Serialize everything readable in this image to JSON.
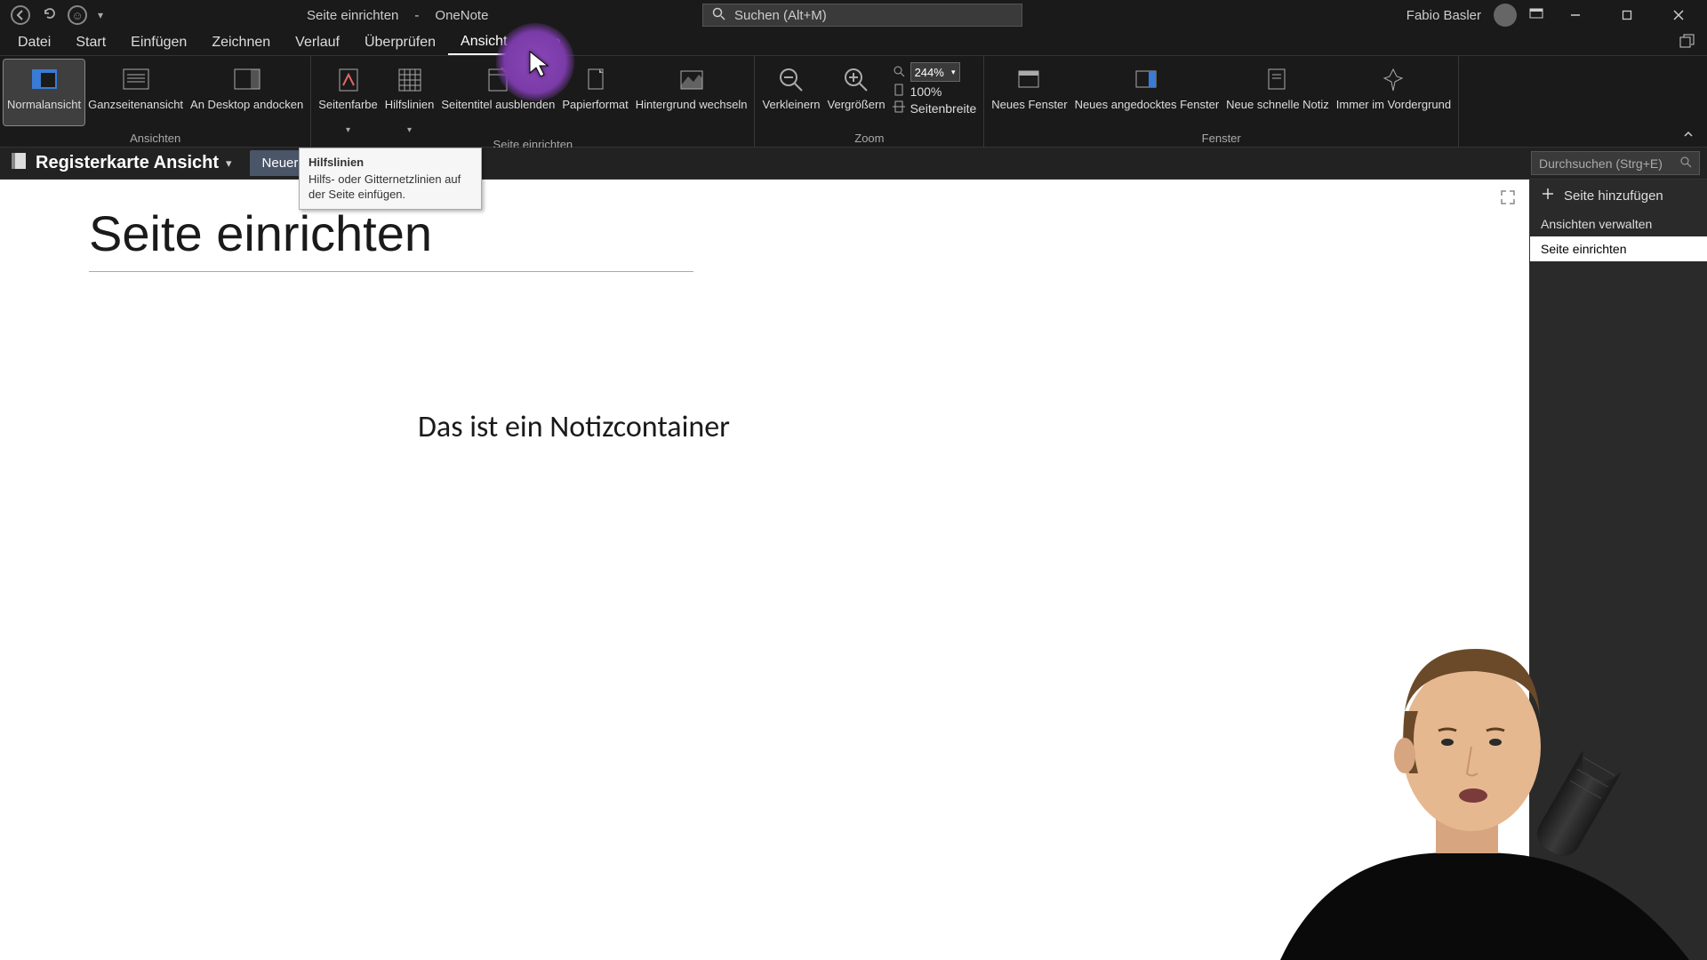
{
  "title_bar": {
    "doc_title": "Seite einrichten",
    "separator": "-",
    "app_name": "OneNote",
    "search_placeholder": "Suchen (Alt+M)",
    "user_name": "Fabio Basler"
  },
  "tabs": {
    "items": [
      "Datei",
      "Start",
      "Einfügen",
      "Zeichnen",
      "Verlauf",
      "Überprüfen",
      "Ansicht",
      "Hilfe"
    ],
    "active_index": 6
  },
  "ribbon": {
    "groups": [
      {
        "label": "Ansichten",
        "buttons": [
          {
            "label": "Normalansicht",
            "name": "normal-view-button",
            "icon": "normal-view-icon",
            "selected": true
          },
          {
            "label": "Ganzseitenansicht",
            "name": "fullpage-view-button",
            "icon": "fullpage-view-icon"
          },
          {
            "label": "An Desktop andocken",
            "name": "dock-to-desktop-button",
            "icon": "dock-icon"
          }
        ]
      },
      {
        "label": "Seite einrichten",
        "buttons": [
          {
            "label": "Seitenfarbe",
            "name": "page-color-button",
            "icon": "page-color-icon",
            "dropdown": true
          },
          {
            "label": "Hilfslinien",
            "name": "rule-lines-button",
            "icon": "rule-lines-icon",
            "dropdown": true
          },
          {
            "label": "Seitentitel ausblenden",
            "name": "hide-title-button",
            "icon": "hide-title-icon"
          },
          {
            "label": "Papierformat",
            "name": "paper-size-button",
            "icon": "paper-size-icon"
          },
          {
            "label": "Hintergrund wechseln",
            "name": "change-background-button",
            "icon": "change-background-icon"
          }
        ]
      },
      {
        "label": "Zoom",
        "buttons": [
          {
            "label": "Verkleinern",
            "name": "zoom-out-button",
            "icon": "zoom-out-icon"
          },
          {
            "label": "Vergrößern",
            "name": "zoom-in-button",
            "icon": "zoom-in-icon"
          }
        ],
        "zoom_value": "244%",
        "zoom_100": "100%",
        "page_width": "Seitenbreite"
      },
      {
        "label": "Fenster",
        "buttons": [
          {
            "label": "Neues Fenster",
            "name": "new-window-button",
            "icon": "new-window-icon"
          },
          {
            "label": "Neues angedocktes Fenster",
            "name": "new-docked-window-button",
            "icon": "new-docked-window-icon"
          },
          {
            "label": "Neue schnelle Notiz",
            "name": "quick-note-button",
            "icon": "quick-note-icon"
          },
          {
            "label": "Immer im Vordergrund",
            "name": "always-on-top-button",
            "icon": "always-on-top-icon"
          }
        ]
      }
    ]
  },
  "tooltip": {
    "title": "Hilfslinien",
    "body": "Hilfs- oder Gitternetzlinien auf der Seite einfügen."
  },
  "notebook_bar": {
    "notebook_name": "Registerkarte Ansicht",
    "section_active": "Neuer Absch",
    "page_search_placeholder": "Durchsuchen (Strg+E)"
  },
  "page": {
    "title": "Seite einrichten",
    "body": "Das ist ein Notizcontainer"
  },
  "page_pane": {
    "add_page": "Seite hinzufügen",
    "header": "Ansichten verwalten",
    "items": [
      {
        "label": "Seite einrichten",
        "active": true
      }
    ]
  }
}
